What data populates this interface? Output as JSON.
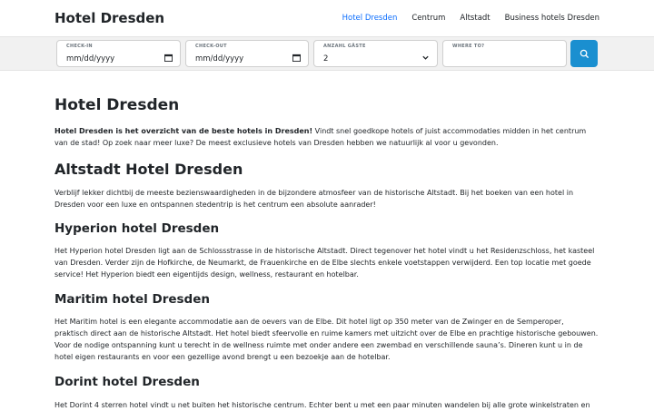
{
  "header": {
    "brand": "Hotel Dresden",
    "nav": [
      {
        "label": "Hotel Dresden"
      },
      {
        "label": "Centrum"
      },
      {
        "label": "Altstadt"
      },
      {
        "label": "Business hotels Dresden"
      }
    ]
  },
  "search": {
    "checkin": {
      "label": "CHECK-IN",
      "value": "mm/dd/yyyy"
    },
    "checkout": {
      "label": "CHECK-OUT",
      "value": "mm/dd/yyyy"
    },
    "guests": {
      "label": "ANZAHL GÄSTE",
      "value": "2"
    },
    "where": {
      "label": "WHERE TO?",
      "value": ""
    }
  },
  "main": {
    "title": "Hotel Dresden",
    "intro_bold": "Hotel Dresden is het overzicht van de beste hotels in Dresden!",
    "intro_rest": " Vindt snel goedkope hotels of juist accommodaties midden in het centrum van de stad! Op zoek naar meer luxe? De meest exclusieve hotels van Dresden hebben we natuurlijk al voor u gevonden.",
    "sections": [
      {
        "heading": "Altstadt Hotel Dresden",
        "text": "Verblijf lekker dichtbij de meeste bezienswaardigheden in de bijzondere atmosfeer van de historische Altstadt. Bij het boeken van een hotel in Dresden voor een luxe en ontspannen stedentrip is het centrum een absolute aanrader!"
      },
      {
        "heading": "Hyperion hotel Dresden",
        "text": "Het Hyperion hotel Dresden ligt aan de Schlossstrasse in de historische Altstadt. Direct tegenover het hotel vindt u het Residenzschloss, het kasteel van Dresden. Verder zijn de Hofkirche, de Neumarkt, de Frauenkirche en de Elbe slechts enkele voetstappen verwijderd. Een top locatie met goede service! Het Hyperion biedt een eigentijds design, wellness, restaurant en hotelbar."
      },
      {
        "heading": "Maritim hotel Dresden",
        "text": "Het Maritim hotel is een elegante accommodatie aan de oevers van de Elbe. Dit hotel ligt op 350 meter van de Zwinger en de Semperoper, praktisch direct aan de historische Altstadt. Het hotel biedt sfeervolle en ruime kamers met uitzicht over de Elbe en prachtige historische gebouwen. Voor de nodige ontspanning kunt u terecht in de wellness ruimte met onder andere een zwembad en verschillende sauna’s. Dineren kunt u in de hotel eigen restaurants en voor een gezellige avond brengt u een bezoekje aan de hotelbar."
      },
      {
        "heading": "Dorint hotel Dresden",
        "text": "Het Dorint 4 sterren hotel vindt u net buiten het historische centrum. Echter bent u met een paar minuten wandelen bij alle grote winkelstraten en"
      }
    ]
  }
}
